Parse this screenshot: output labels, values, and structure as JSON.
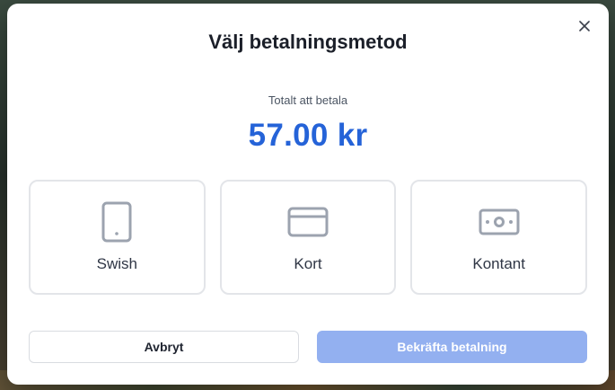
{
  "dialog": {
    "title": "Välj betalningsmetod",
    "total_label": "Totalt att betala",
    "total_amount": "57.00 kr",
    "close_icon": "close-icon"
  },
  "methods": [
    {
      "label": "Swish",
      "icon": "phone-icon"
    },
    {
      "label": "Kort",
      "icon": "credit-card-icon"
    },
    {
      "label": "Kontant",
      "icon": "cash-icon"
    }
  ],
  "actions": {
    "cancel_label": "Avbryt",
    "confirm_label": "Bekräfta betalning",
    "confirm_disabled": true
  },
  "colors": {
    "accent": "#2563d8",
    "confirm_disabled_bg": "#93b0f0",
    "icon_gray": "#9ca3af"
  }
}
